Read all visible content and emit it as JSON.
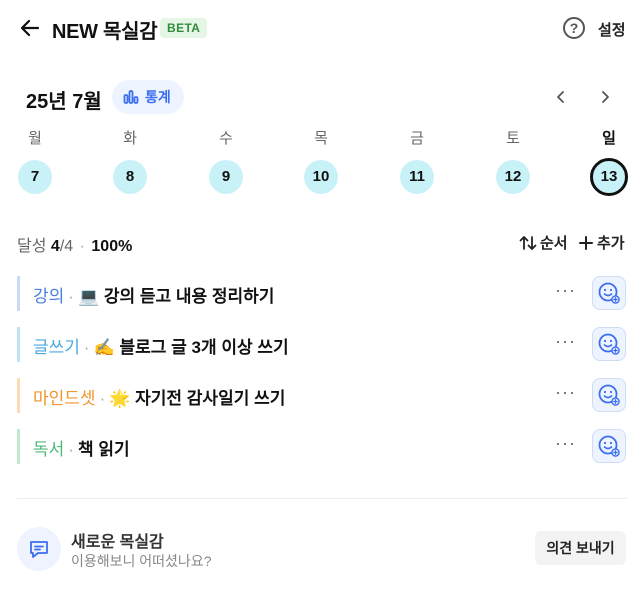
{
  "header": {
    "title": "NEW 목실감",
    "badge": "BETA",
    "help_glyph": "?",
    "settings_label": "설정"
  },
  "calendar": {
    "month_label": "25년 7월",
    "stats_label": "통계",
    "days": [
      {
        "dow": "월",
        "date": "7"
      },
      {
        "dow": "화",
        "date": "8"
      },
      {
        "dow": "수",
        "date": "9"
      },
      {
        "dow": "목",
        "date": "10"
      },
      {
        "dow": "금",
        "date": "11"
      },
      {
        "dow": "토",
        "date": "12"
      },
      {
        "dow": "일",
        "date": "13"
      }
    ],
    "selected_date": "13"
  },
  "summary": {
    "label": "달성",
    "done": "4",
    "total": "/4",
    "separator": "·",
    "percent": "100%",
    "sort_label": "순서",
    "add_label": "추가"
  },
  "goals": [
    {
      "category": "강의",
      "emoji": "💻",
      "name": "강의 듣고 내용 정리하기",
      "color": "#4a7fe0"
    },
    {
      "category": "글쓰기",
      "emoji": "✍️",
      "name": "블로그 글 3개 이상 쓰기",
      "color": "#4aa9e0"
    },
    {
      "category": "마인드셋",
      "emoji": "🌟",
      "name": "자기전 감사일기 쓰기",
      "color": "#f0952c"
    },
    {
      "category": "독서",
      "emoji": "",
      "name": "책 읽기",
      "color": "#4cb977"
    }
  ],
  "goal_more": "···",
  "feedback": {
    "title": "새로운 목실감",
    "subtitle": "이용해보니 어떠셨나요?",
    "button": "의견 보내기"
  },
  "colors": {
    "accent": "#3b6ef0",
    "date_circle": "#c9f1f8",
    "beta_bg": "#e6f6e6",
    "beta_text": "#2f8d3b"
  },
  "icons": {
    "back": "arrow-left-icon",
    "help": "question-circle-icon",
    "stats": "bar-chart-icon",
    "prev": "chevron-left-icon",
    "next": "chevron-right-icon",
    "sort": "sort-arrows-icon",
    "add": "plus-icon",
    "react": "smile-add-icon",
    "feedback": "message-icon"
  }
}
